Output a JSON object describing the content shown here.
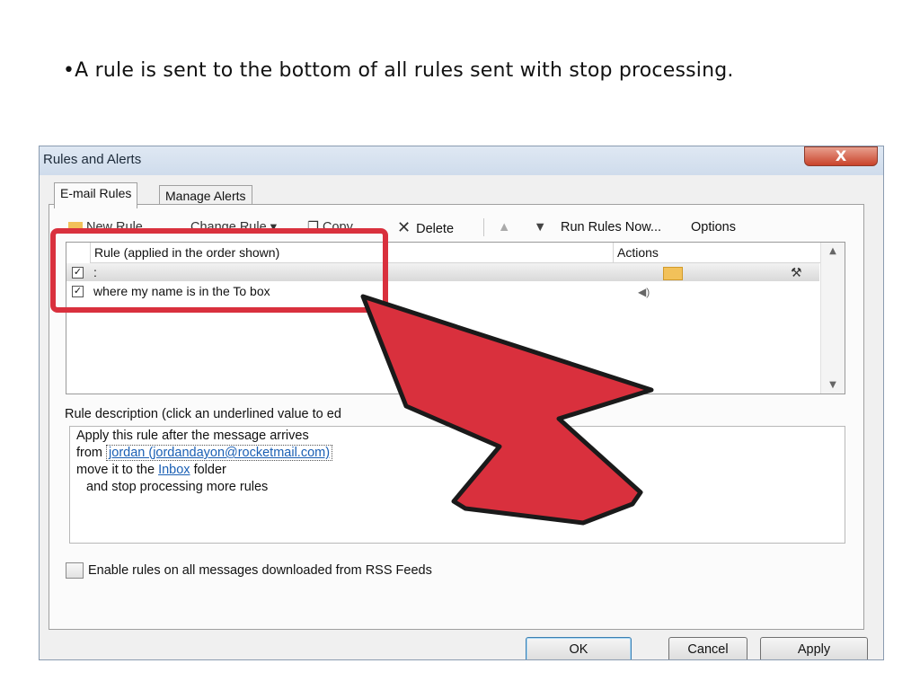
{
  "slide": {
    "bullet_text": "•A rule is sent to the bottom of all rules sent with stop processing."
  },
  "dialog": {
    "title": "Rules and Alerts",
    "close_glyph": "X",
    "tabs": [
      {
        "label": "E-mail Rules"
      },
      {
        "label": "Manage Alerts"
      }
    ],
    "toolbar": {
      "new_rule": "New Rule",
      "change_rule": "Change Rule",
      "copy": "Copy",
      "delete": "Delete",
      "run_rules_now": "Run Rules Now...",
      "options": "Options"
    },
    "list": {
      "col_rule": "Rule (applied in the order shown)",
      "col_actions": "Actions",
      "rows": [
        {
          "name": ":",
          "checked": true,
          "selected": true
        },
        {
          "name": "where my name is in the To box",
          "checked": true,
          "selected": false
        }
      ]
    },
    "description": {
      "label": "Rule description (click an underlined value to ed",
      "line1": "Apply this rule after the message arrives",
      "line2_prefix": "from",
      "line2_link": "jordan (jordandayon@rocketmail.com)",
      "line3_prefix": "move it to the",
      "line3_link": "Inbox",
      "line3_suffix": "folder",
      "line4": "and stop processing more rules"
    },
    "rss_label": "Enable rules on all messages downloaded from RSS Feeds",
    "buttons": {
      "ok": "OK",
      "cancel": "Cancel",
      "apply": "Apply"
    }
  },
  "colors": {
    "highlight": "#d9303d",
    "arrow": "#d9303d",
    "link": "#1a5fb4"
  }
}
